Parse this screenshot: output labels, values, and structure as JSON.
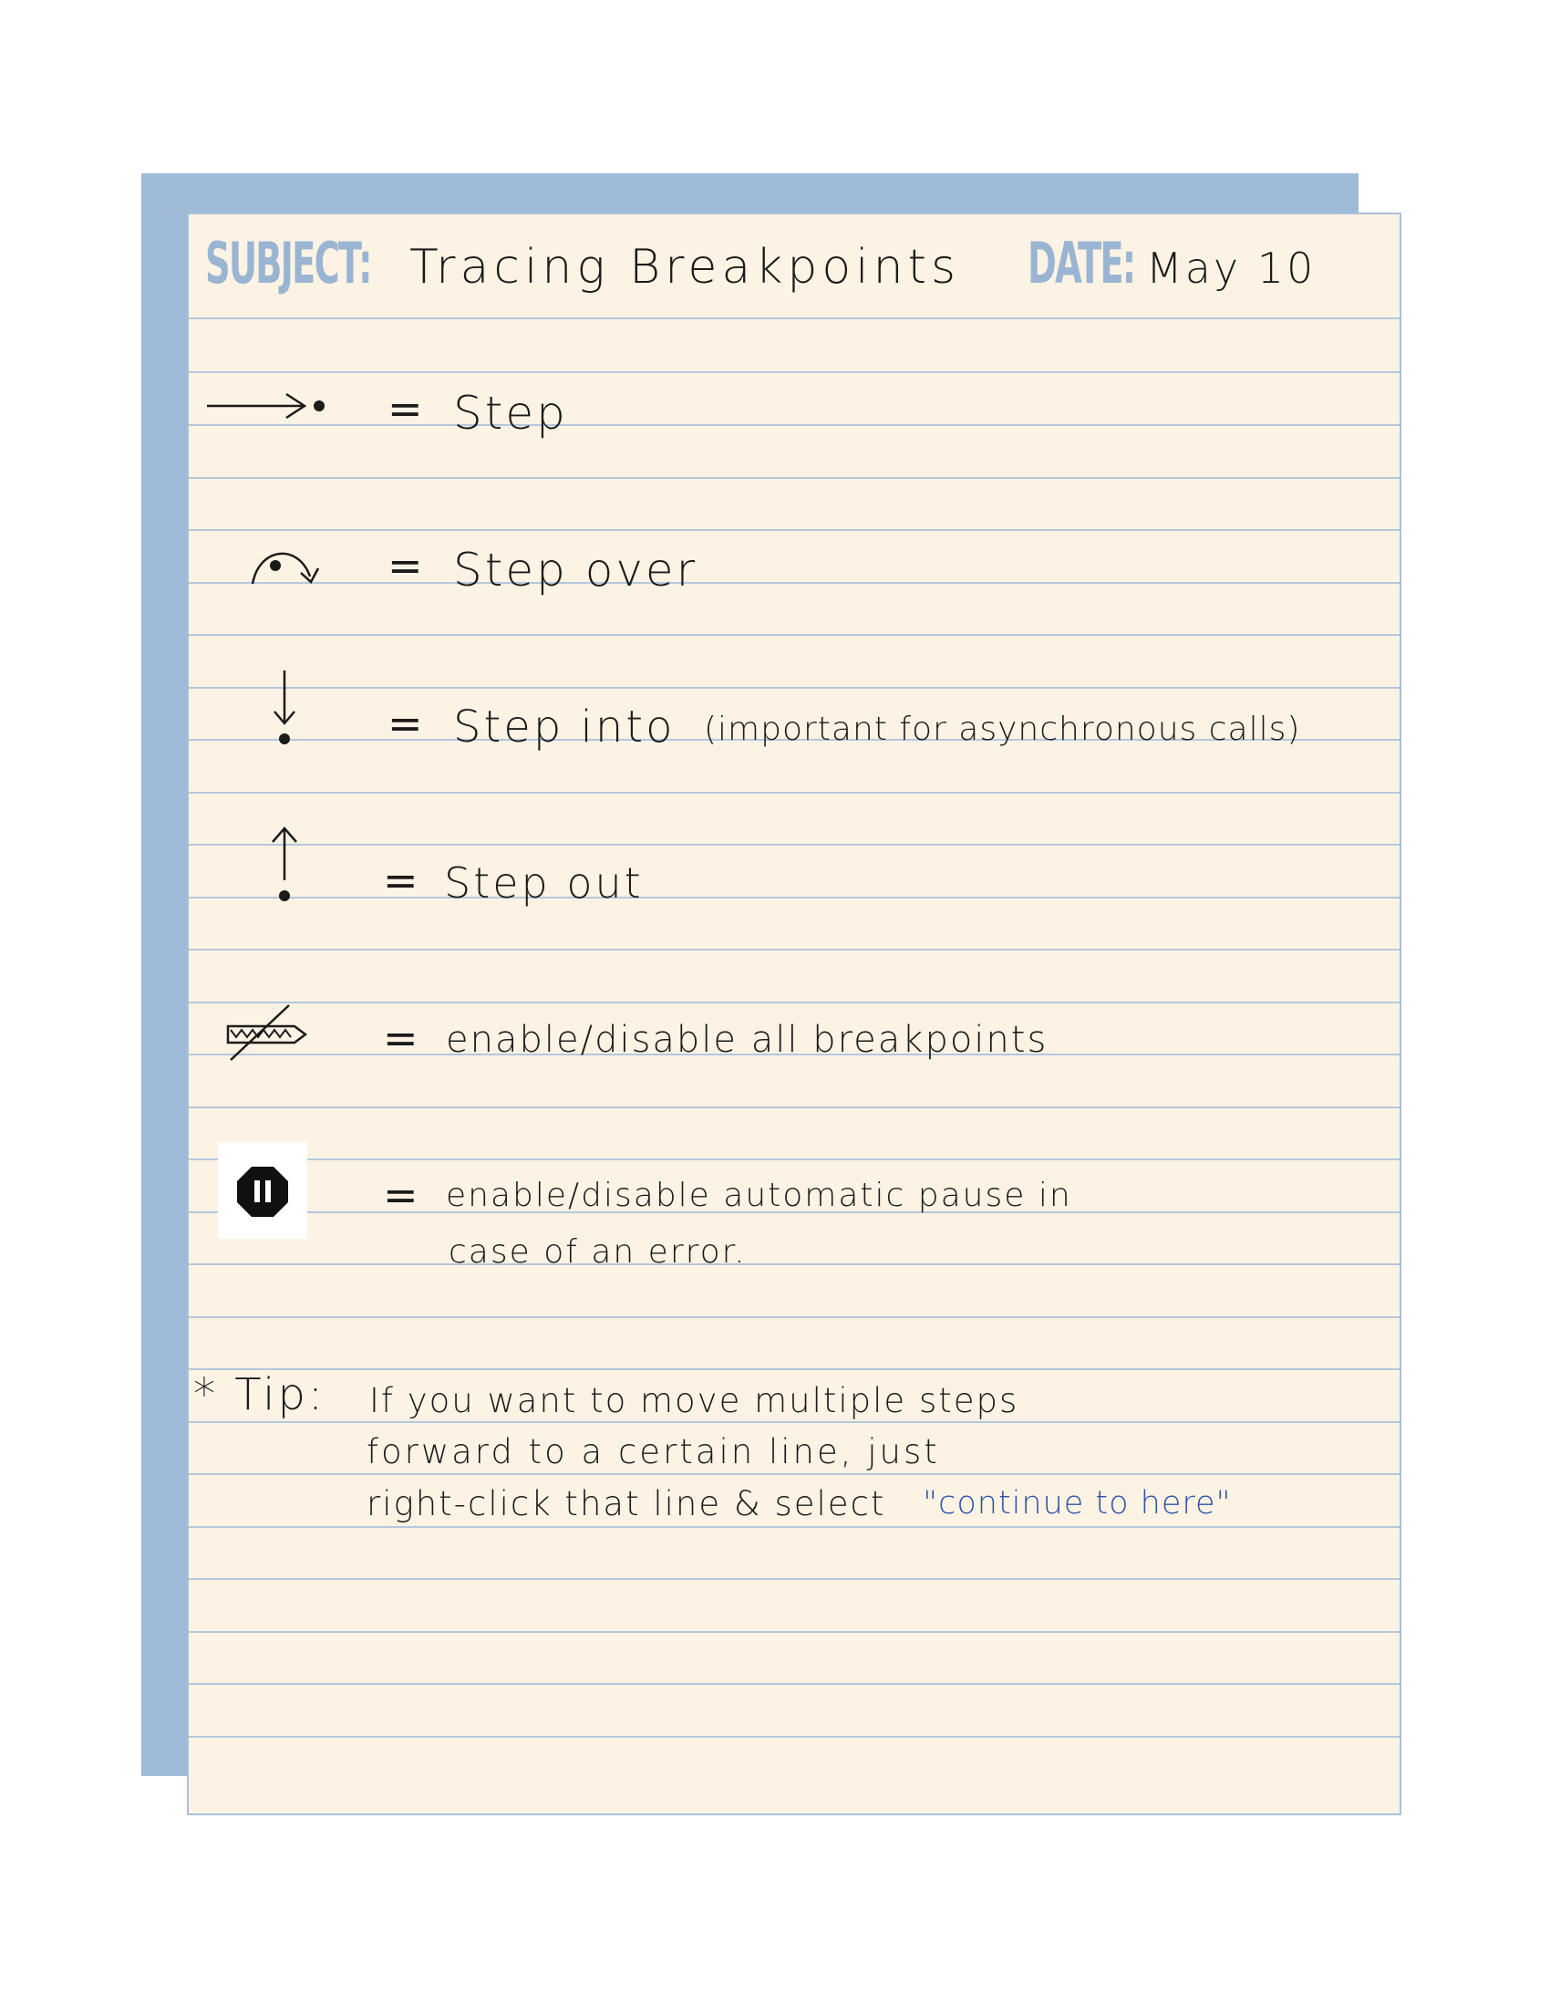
{
  "header": {
    "subject_label": "SUBJECT:",
    "subject_value": "Tracing Breakpoints",
    "date_label": "DATE:",
    "date_value": "May 10"
  },
  "legend": [
    {
      "icon": "step-icon",
      "label": "Step",
      "note": ""
    },
    {
      "icon": "step-over-icon",
      "label": "Step over",
      "note": ""
    },
    {
      "icon": "step-into-icon",
      "label": "Step into",
      "note": "(important for asynchronous calls)"
    },
    {
      "icon": "step-out-icon",
      "label": "Step out",
      "note": ""
    },
    {
      "icon": "deactivate-breakpoints-icon",
      "label": "enable/disable all breakpoints",
      "note": ""
    },
    {
      "icon": "pause-on-exceptions-icon",
      "label": "enable/disable automatic pause in",
      "label_line2": "case of an error."
    }
  ],
  "equals": "=",
  "tip": {
    "marker": "* Tip:",
    "line1": "If you want to move multiple steps",
    "line2": "forward to a certain line, just",
    "line3": "right-click that line & select",
    "quote": "\"continue to here\""
  },
  "colors": {
    "paper": "#fdf3e5",
    "rule": "#b4c7dc",
    "accent_blue": "#9fbad6",
    "quote_blue": "#2e53a8"
  }
}
